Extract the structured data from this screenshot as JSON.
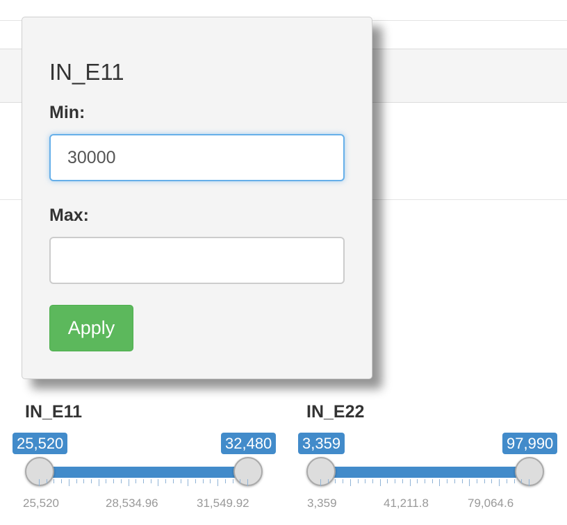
{
  "popover": {
    "title": "IN_E11",
    "min_label": "Min:",
    "min_value": "30000",
    "max_label": "Max:",
    "max_value": "",
    "apply_label": "Apply"
  },
  "sliders": [
    {
      "label": "IN_E11",
      "min_value": "25,520",
      "max_value": "32,480",
      "grid_labels": [
        "25,520",
        "28,534.96",
        "31,549.92"
      ]
    },
    {
      "label": "IN_E22",
      "min_value": "3,359",
      "max_value": "97,990",
      "grid_labels": [
        "3,359",
        "41,211.8",
        "79,064.6"
      ]
    }
  ],
  "colors": {
    "accent": "#428bca",
    "apply": "#5cb85c",
    "focus": "#66afe9"
  }
}
